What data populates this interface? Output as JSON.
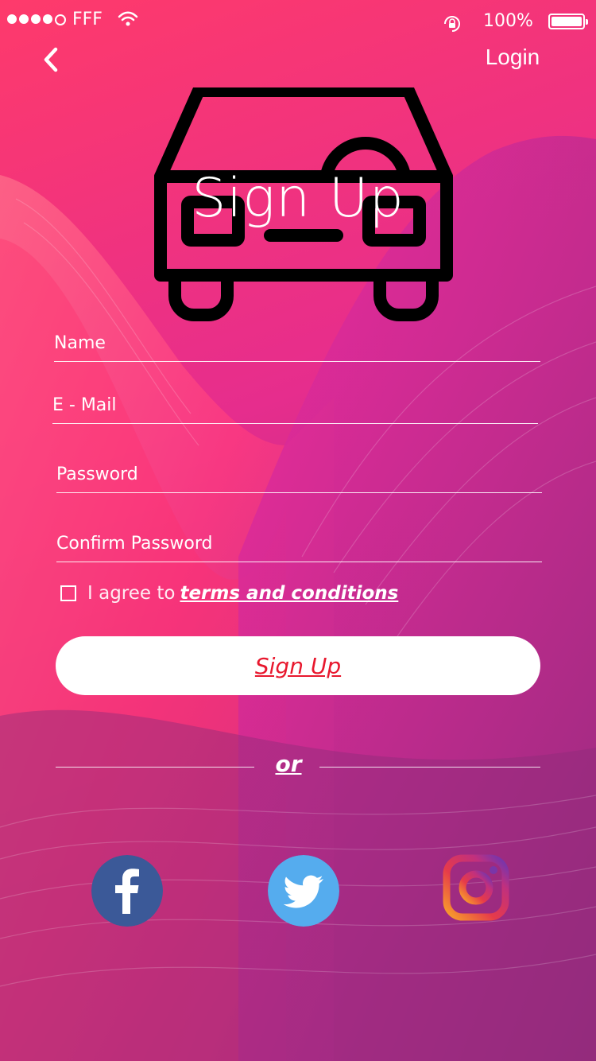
{
  "status_bar": {
    "carrier": "FFF",
    "battery_percent": "100%",
    "battery_level": 1.0
  },
  "nav": {
    "back_icon": "chevron-left-icon",
    "login_label": "Login"
  },
  "header": {
    "icon": "car-icon",
    "title": "Sign Up"
  },
  "form": {
    "fields": [
      {
        "label": "Name"
      },
      {
        "label": "E - Mail"
      },
      {
        "label": "Password"
      },
      {
        "label": "Confirm Password"
      }
    ],
    "terms_prefix": "I agree to",
    "terms_link": "terms and conditions",
    "submit_label": "Sign Up"
  },
  "divider": {
    "label": "or"
  },
  "social": [
    {
      "name": "facebook-icon",
      "color": "#3b5998"
    },
    {
      "name": "twitter-icon",
      "color": "#55acee"
    },
    {
      "name": "instagram-icon",
      "color": "#e4405f"
    }
  ],
  "colors": {
    "gradient_top": "#fe3a6b",
    "gradient_bottom": "#8f2c7a",
    "button_text": "#e8182e"
  }
}
